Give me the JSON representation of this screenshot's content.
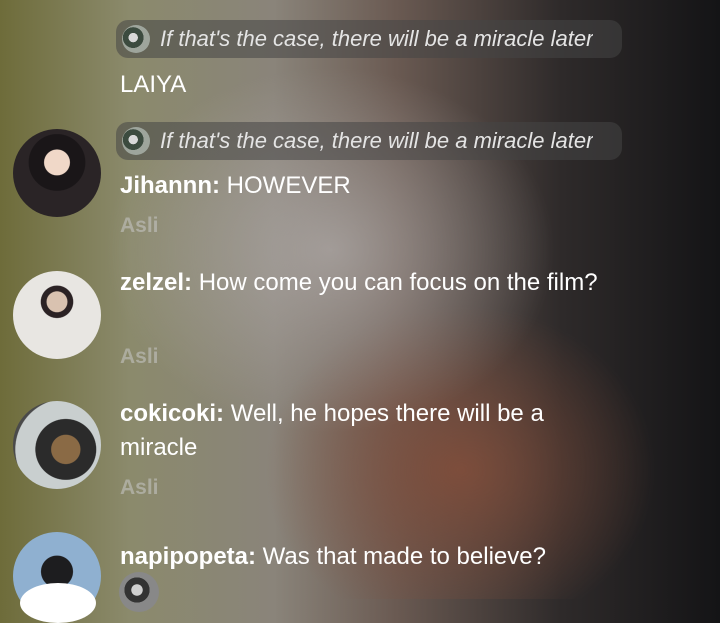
{
  "reply_preview": {
    "text": "If that's the case, there will be a miracle later"
  },
  "messages": [
    {
      "author": "",
      "text": "LAIYA",
      "sub": ""
    },
    {
      "author": "Jihannn:",
      "text": "HOWEVER",
      "sub": "Asli"
    },
    {
      "author": "zelzel:",
      "text": "How come you can focus on the film?",
      "sub": "Asli"
    },
    {
      "author": "cokicoki:",
      "text": "Well, he hopes there will be a miracle",
      "sub": "Asli"
    },
    {
      "author": "napipopeta:",
      "text": "Was that made to believe?",
      "sub": ""
    }
  ]
}
